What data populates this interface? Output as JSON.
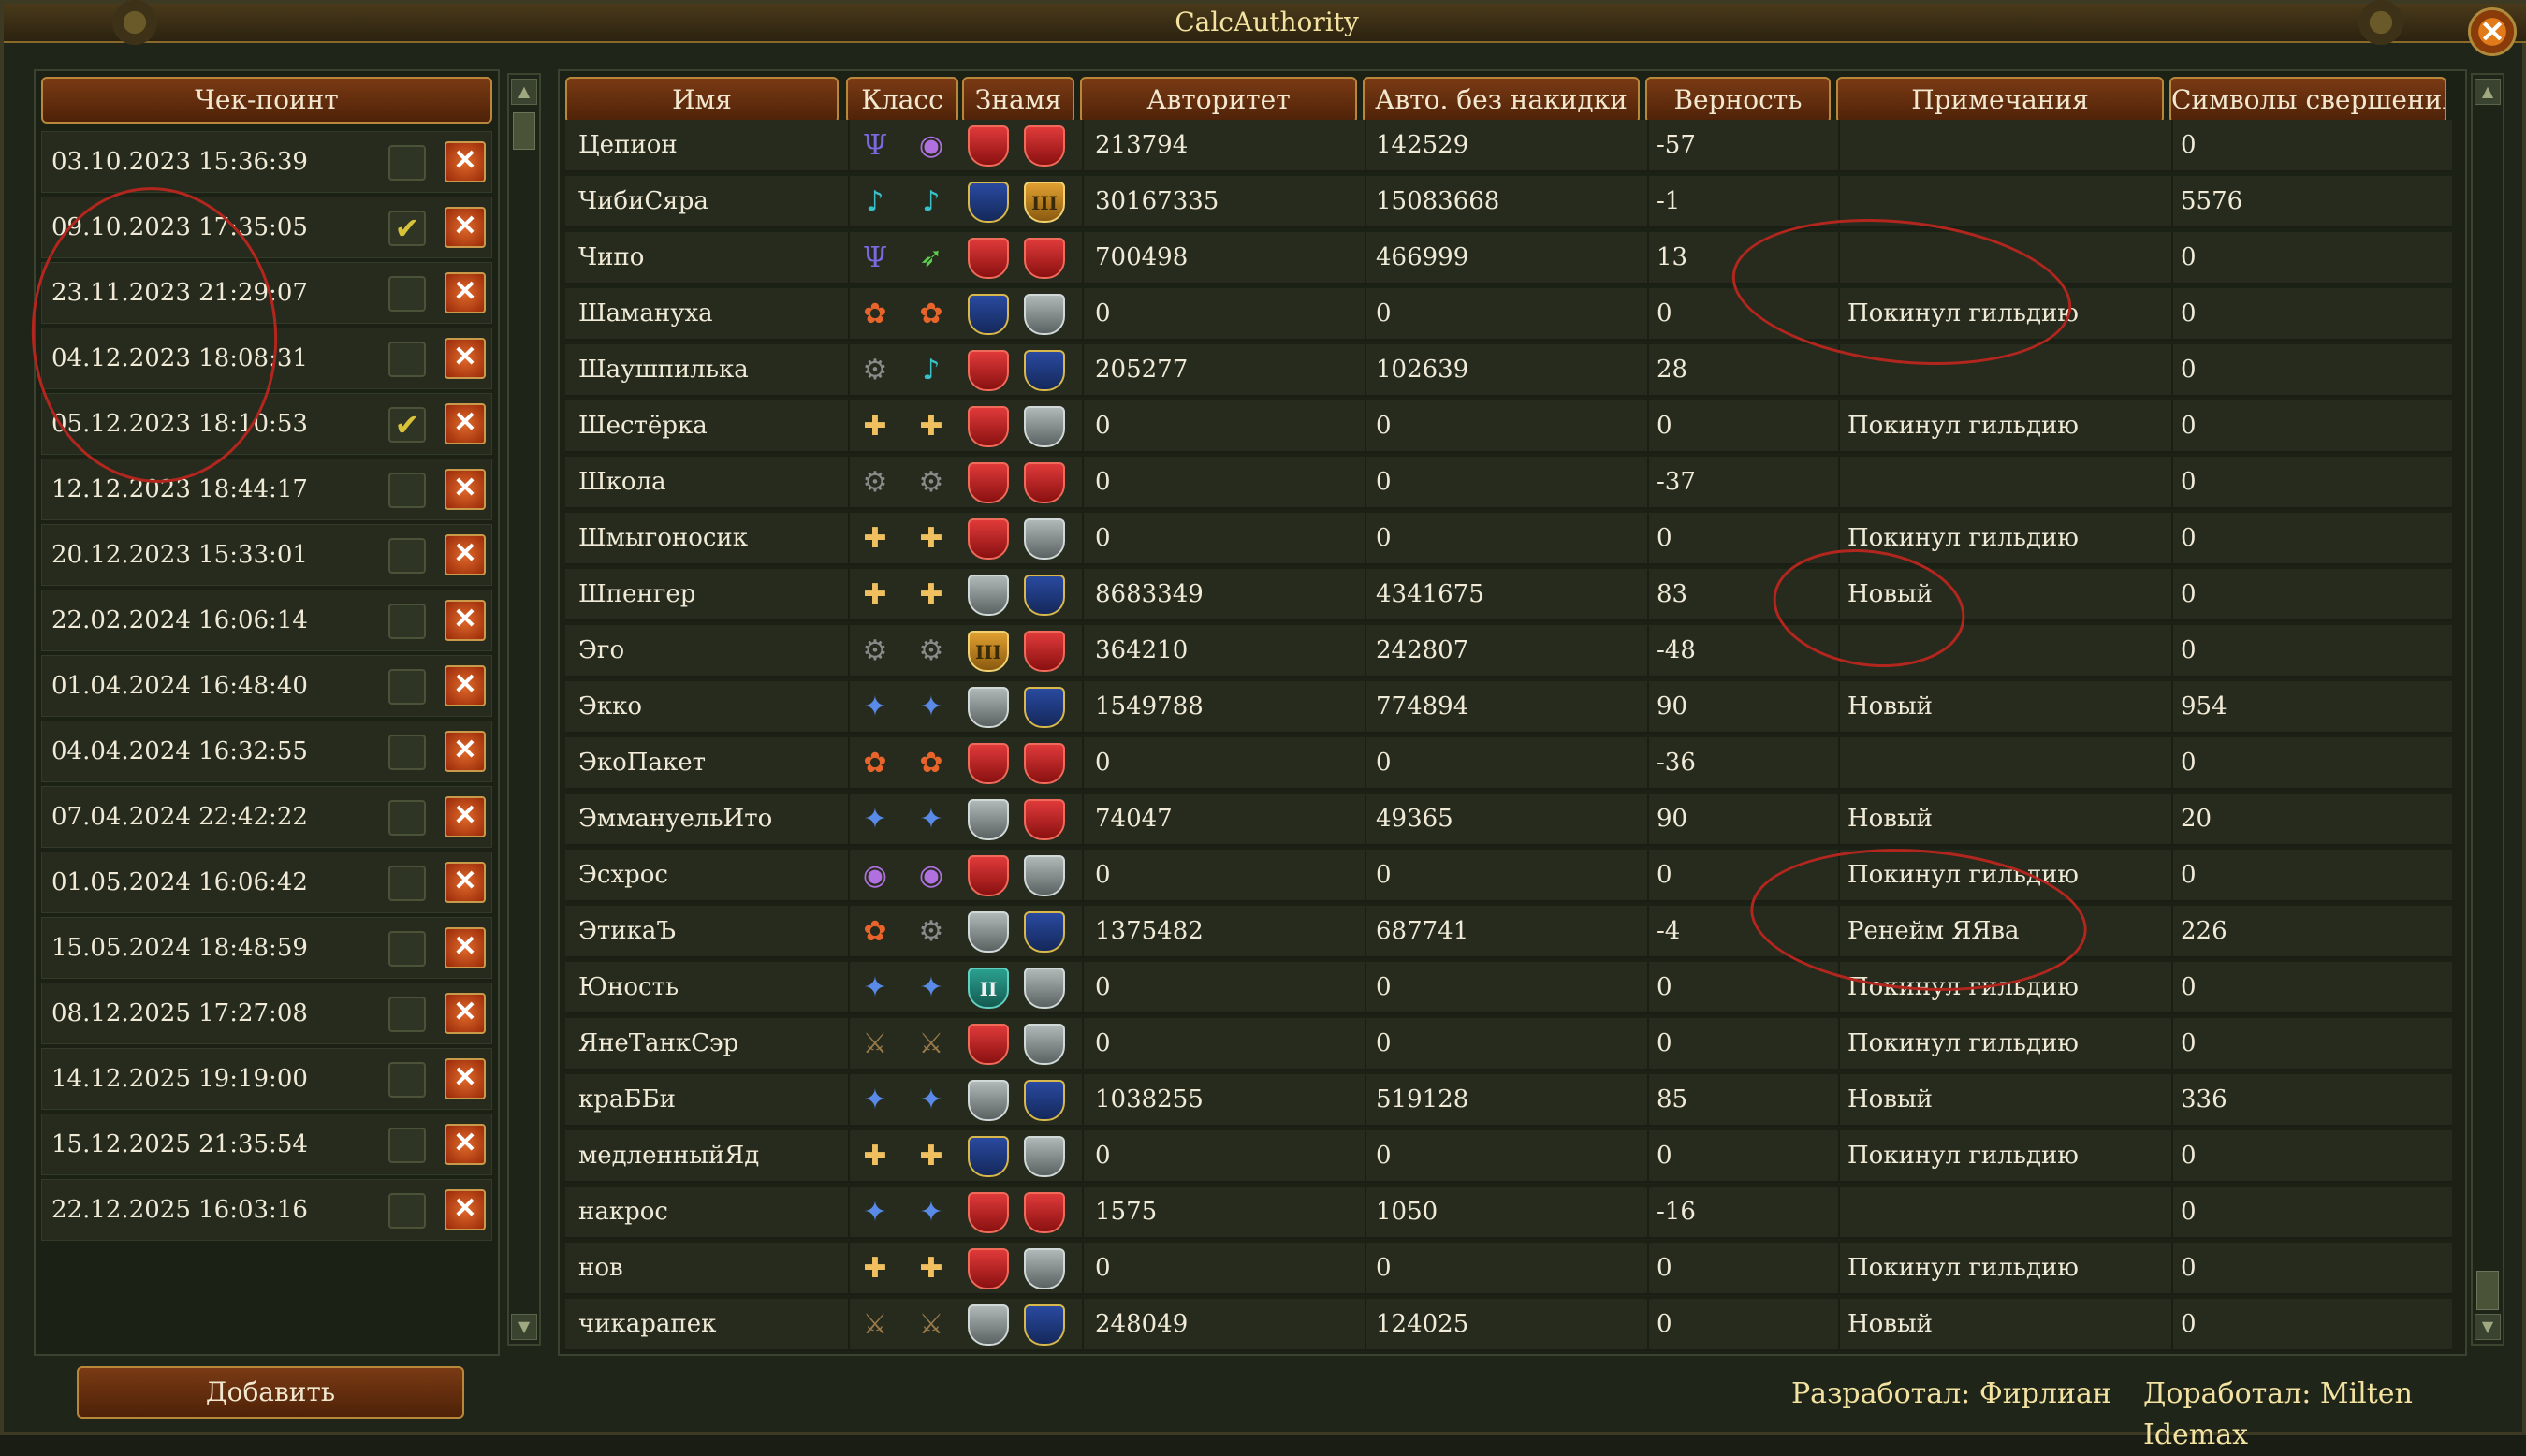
{
  "window": {
    "title": "CalcAuthority",
    "close_label": "✕"
  },
  "checkpoints": {
    "header": "Чек-поинт",
    "add_label": "Добавить",
    "items": [
      {
        "date": "03.10.2023 15:36:39",
        "checked": false
      },
      {
        "date": "09.10.2023 17:35:05",
        "checked": true
      },
      {
        "date": "23.11.2023 21:29:07",
        "checked": false
      },
      {
        "date": "04.12.2023 18:08:31",
        "checked": false
      },
      {
        "date": "05.12.2023 18:10:53",
        "checked": true
      },
      {
        "date": "12.12.2023 18:44:17",
        "checked": false
      },
      {
        "date": "20.12.2023 15:33:01",
        "checked": false
      },
      {
        "date": "22.02.2024 16:06:14",
        "checked": false
      },
      {
        "date": "01.04.2024 16:48:40",
        "checked": false
      },
      {
        "date": "04.04.2024 16:32:55",
        "checked": false
      },
      {
        "date": "07.04.2024 22:42:22",
        "checked": false
      },
      {
        "date": "01.05.2024 16:06:42",
        "checked": false
      },
      {
        "date": "15.05.2024 18:48:59",
        "checked": false
      },
      {
        "date": "08.12.2025 17:27:08",
        "checked": false
      },
      {
        "date": "14.12.2025 19:19:00",
        "checked": false
      },
      {
        "date": "15.12.2025 21:35:54",
        "checked": false
      },
      {
        "date": "22.12.2025 16:03:16",
        "checked": false
      }
    ],
    "check_glyph": "✔",
    "delete_glyph": "✕"
  },
  "table": {
    "columns": [
      "Имя",
      "Класс",
      "Знамя",
      "Авторитет",
      "Авто. без накидки",
      "Верность",
      "Примечания",
      "Символы свершения"
    ],
    "rows": [
      {
        "name": "Цепион",
        "classes": [
          "mystic-icon",
          "seer-icon"
        ],
        "banners": [
          "red",
          "red"
        ],
        "authority": "213794",
        "auto": "142529",
        "loyalty": "-57",
        "note": "",
        "symbols": "0"
      },
      {
        "name": "ЧибиСяра",
        "classes": [
          "bard-icon",
          "bard-icon"
        ],
        "banners": [
          "blue",
          "gold"
        ],
        "authority": "30167335",
        "auto": "15083668",
        "loyalty": "-1",
        "note": "",
        "symbols": "5576"
      },
      {
        "name": "Чипо",
        "classes": [
          "mystic-icon",
          "ranger-icon"
        ],
        "banners": [
          "red",
          "red"
        ],
        "authority": "700498",
        "auto": "466999",
        "loyalty": "13",
        "note": "",
        "symbols": "0"
      },
      {
        "name": "Шамануха",
        "classes": [
          "druid-icon",
          "druid-icon"
        ],
        "banners": [
          "blue",
          "grey"
        ],
        "authority": "0",
        "auto": "0",
        "loyalty": "0",
        "note": "Покинул гильдию",
        "symbols": "0"
      },
      {
        "name": "Шаушпилька",
        "classes": [
          "engineer-icon",
          "bard-icon"
        ],
        "banners": [
          "red",
          "blue"
        ],
        "authority": "205277",
        "auto": "102639",
        "loyalty": "28",
        "note": "",
        "symbols": "0"
      },
      {
        "name": "Шестёрка",
        "classes": [
          "priest-icon",
          "priest-icon"
        ],
        "banners": [
          "red",
          "grey"
        ],
        "authority": "0",
        "auto": "0",
        "loyalty": "0",
        "note": "Покинул гильдию",
        "symbols": "0"
      },
      {
        "name": "Школа",
        "classes": [
          "engineer-icon",
          "engineer-icon"
        ],
        "banners": [
          "red",
          "red"
        ],
        "authority": "0",
        "auto": "0",
        "loyalty": "-37",
        "note": "",
        "symbols": "0"
      },
      {
        "name": "Шмыгоносик",
        "classes": [
          "priest-icon",
          "priest-icon"
        ],
        "banners": [
          "red",
          "grey"
        ],
        "authority": "0",
        "auto": "0",
        "loyalty": "0",
        "note": "Покинул гильдию",
        "symbols": "0"
      },
      {
        "name": "Шпенгер",
        "classes": [
          "priest-icon",
          "priest-icon"
        ],
        "banners": [
          "grey",
          "blue"
        ],
        "authority": "8683349",
        "auto": "4341675",
        "loyalty": "83",
        "note": "Новый",
        "symbols": "0"
      },
      {
        "name": "Эго",
        "classes": [
          "engineer-icon",
          "engineer-icon"
        ],
        "banners": [
          "gold",
          "red"
        ],
        "authority": "364210",
        "auto": "242807",
        "loyalty": "-48",
        "note": "",
        "symbols": "0"
      },
      {
        "name": "Экко",
        "classes": [
          "mage-icon",
          "mage-icon"
        ],
        "banners": [
          "grey",
          "blue"
        ],
        "authority": "1549788",
        "auto": "774894",
        "loyalty": "90",
        "note": "Новый",
        "symbols": "954"
      },
      {
        "name": "ЭкоПакет",
        "classes": [
          "druid-icon",
          "druid-icon"
        ],
        "banners": [
          "red",
          "red"
        ],
        "authority": "0",
        "auto": "0",
        "loyalty": "-36",
        "note": "",
        "symbols": "0"
      },
      {
        "name": "ЭммануельИто",
        "classes": [
          "mage-icon",
          "mage-icon"
        ],
        "banners": [
          "grey",
          "red"
        ],
        "authority": "74047",
        "auto": "49365",
        "loyalty": "90",
        "note": "Новый",
        "symbols": "20"
      },
      {
        "name": "Эсхрос",
        "classes": [
          "seer-icon",
          "seer-icon"
        ],
        "banners": [
          "red",
          "grey"
        ],
        "authority": "0",
        "auto": "0",
        "loyalty": "0",
        "note": "Покинул гильдию",
        "symbols": "0"
      },
      {
        "name": "ЭтикаЪ",
        "classes": [
          "druid-icon",
          "engineer-icon"
        ],
        "banners": [
          "grey",
          "blue"
        ],
        "authority": "1375482",
        "auto": "687741",
        "loyalty": "-4",
        "note": "Ренейм ЯЯва",
        "symbols": "226"
      },
      {
        "name": "Юность",
        "classes": [
          "mage-icon",
          "mage-icon"
        ],
        "banners": [
          "teal",
          "grey"
        ],
        "authority": "0",
        "auto": "0",
        "loyalty": "0",
        "note": "Покинул гильдию",
        "symbols": "0"
      },
      {
        "name": "ЯнеТанкСэр",
        "classes": [
          "warrior-icon",
          "warrior-icon"
        ],
        "banners": [
          "red",
          "grey"
        ],
        "authority": "0",
        "auto": "0",
        "loyalty": "0",
        "note": "Покинул гильдию",
        "symbols": "0"
      },
      {
        "name": "краББи",
        "classes": [
          "mage-icon",
          "mage-icon"
        ],
        "banners": [
          "grey",
          "blue"
        ],
        "authority": "1038255",
        "auto": "519128",
        "loyalty": "85",
        "note": "Новый",
        "symbols": "336"
      },
      {
        "name": "медленныйЯд",
        "classes": [
          "priest-icon",
          "priest-icon"
        ],
        "banners": [
          "blue",
          "grey"
        ],
        "authority": "0",
        "auto": "0",
        "loyalty": "0",
        "note": "Покинул гильдию",
        "symbols": "0"
      },
      {
        "name": "накрос",
        "classes": [
          "mage-icon",
          "mage-icon"
        ],
        "banners": [
          "red",
          "red"
        ],
        "authority": "1575",
        "auto": "1050",
        "loyalty": "-16",
        "note": "",
        "symbols": "0"
      },
      {
        "name": "нов",
        "classes": [
          "priest-icon",
          "priest-icon"
        ],
        "banners": [
          "red",
          "grey"
        ],
        "authority": "0",
        "auto": "0",
        "loyalty": "0",
        "note": "Покинул гильдию",
        "symbols": "0"
      },
      {
        "name": "чикарапек",
        "classes": [
          "warrior-icon",
          "warrior-icon"
        ],
        "banners": [
          "grey",
          "blue"
        ],
        "authority": "248049",
        "auto": "124025",
        "loyalty": "0",
        "note": "Новый",
        "symbols": "0"
      }
    ]
  },
  "footer": {
    "developed": "Разработал: Фирлиан",
    "refined": "Доработал: Milten Idemax"
  }
}
